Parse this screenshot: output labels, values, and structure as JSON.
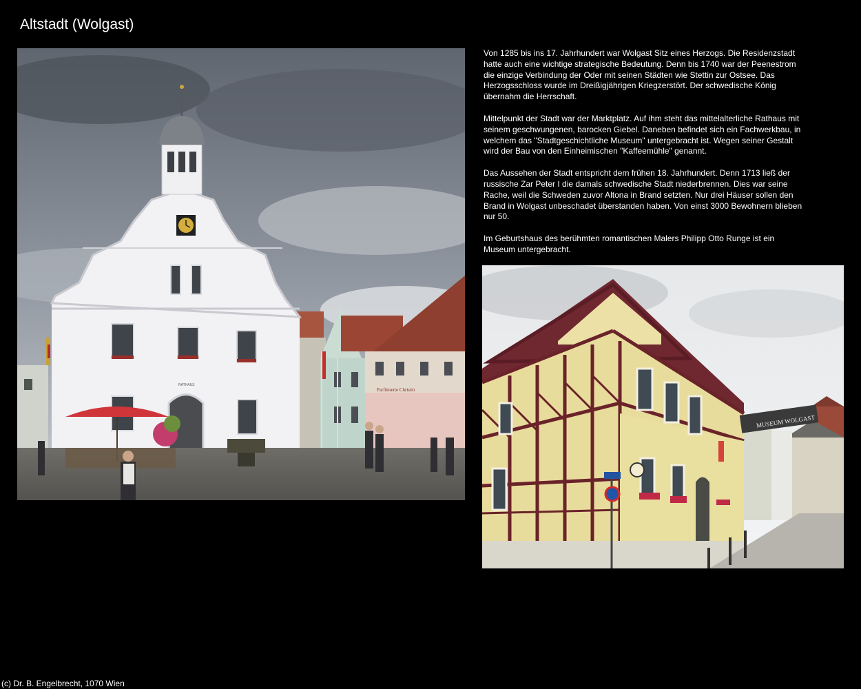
{
  "page": {
    "title": "Altstadt (Wolgast)",
    "footer": "(c) Dr. B. Engelbrecht, 1070 Wien"
  },
  "description": [
    "Von 1285 bis ins 17. Jahrhundert war Wolgast Sitz eines Herzogs. Die Residenzstadt hatte auch eine wichtige strategische Bedeutung. Denn bis 1740 war der Peenestrom die einzige Verbindung der Oder mit seinen Städten wie Stettin zur Ostsee. Das Herzogsschloss wurde im Dreißigjährigen Kriegzerstört. Der schwedische König übernahm die Herrschaft.",
    "Mittelpunkt der Stadt war der Marktplatz. Auf ihm steht das mittelalterliche Rathaus mit seinem geschwungenen, barocken Giebel. Daneben befindet sich ein Fachwerkbau, in welchem das \"Stadtgeschichtliche Museum\" untergebracht ist. Wegen seiner Gestalt wird der Bau von den Einheimischen \"Kaffeemühle\" genannt.",
    "Das Aussehen der Stadt entspricht dem frühen 18. Jahrhundert. Denn 1713 ließ der russische Zar Peter I die damals schwedische Stadt niederbrennen. Dies war seine Rache, weil die Schweden zuvor Altona in Brand setzten. Nur drei Häuser sollen den Brand in Wolgast unbeschadet überstanden haben. Von einst 3000 Bewohnern blieben nur 50.",
    "Im Geburtshaus des berühmten romantischen Malers Philipp Otto Runge ist ein Museum untergebracht."
  ],
  "photos": {
    "town_hall": {
      "sign": "RATHAUS",
      "shop_sign": "Parfümerie Christin"
    },
    "museum": {
      "sign": "MUSEUM WOLGAST"
    }
  }
}
